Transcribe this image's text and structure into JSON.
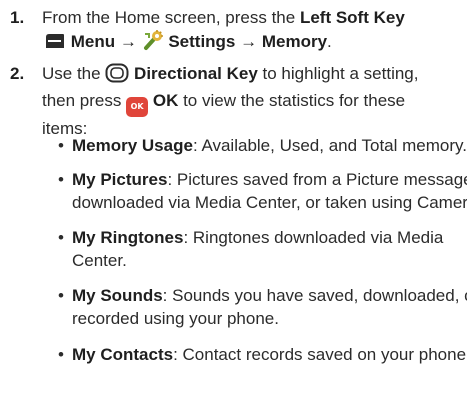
{
  "steps": [
    {
      "number": "1.",
      "line1_prefix": "From the Home screen, press the ",
      "line1_bold": "Left Soft Key",
      "line2_menu": "Menu",
      "arrow1": "→",
      "line2_settings": "Settings",
      "arrow2": "→",
      "line2_memory": "Memory",
      "line2_end": "."
    },
    {
      "number": "2.",
      "line1_prefix": "Use the ",
      "line1_bold": "Directional Key",
      "line1_suffix": " to highlight a setting,",
      "line2_prefix": "then press ",
      "ok_key_label": "OK",
      "line2_bold": "OK",
      "line2_suffix": " to view the statistics for these",
      "line3": "items:"
    }
  ],
  "bullets": [
    {
      "term": "Memory Usage",
      "line1": ": Available, Used, and Total memory.",
      "line2": ""
    },
    {
      "term": "My Pictures",
      "line1": ": Pictures saved from a Picture message,",
      "line2": "downloaded via Media Center, or taken using Camera."
    },
    {
      "term": "My Ringtones",
      "line1": ": Ringtones downloaded via Media",
      "line2": "Center."
    },
    {
      "term": "My Sounds",
      "line1": ": Sounds you have saved, downloaded, or",
      "line2": "recorded using your phone."
    },
    {
      "term": "My Contacts",
      "line1": ": Contact records saved on your phone.",
      "line2": ""
    }
  ],
  "bullet_symbol": "•",
  "icons": {
    "left_soft_key": "left-soft-key-icon",
    "settings": "settings-icon",
    "directional_key": "directional-key-icon",
    "ok_key": "ok-key-icon"
  },
  "colors": {
    "ok_key": "#e0453a",
    "text": "#2b2b2b"
  }
}
